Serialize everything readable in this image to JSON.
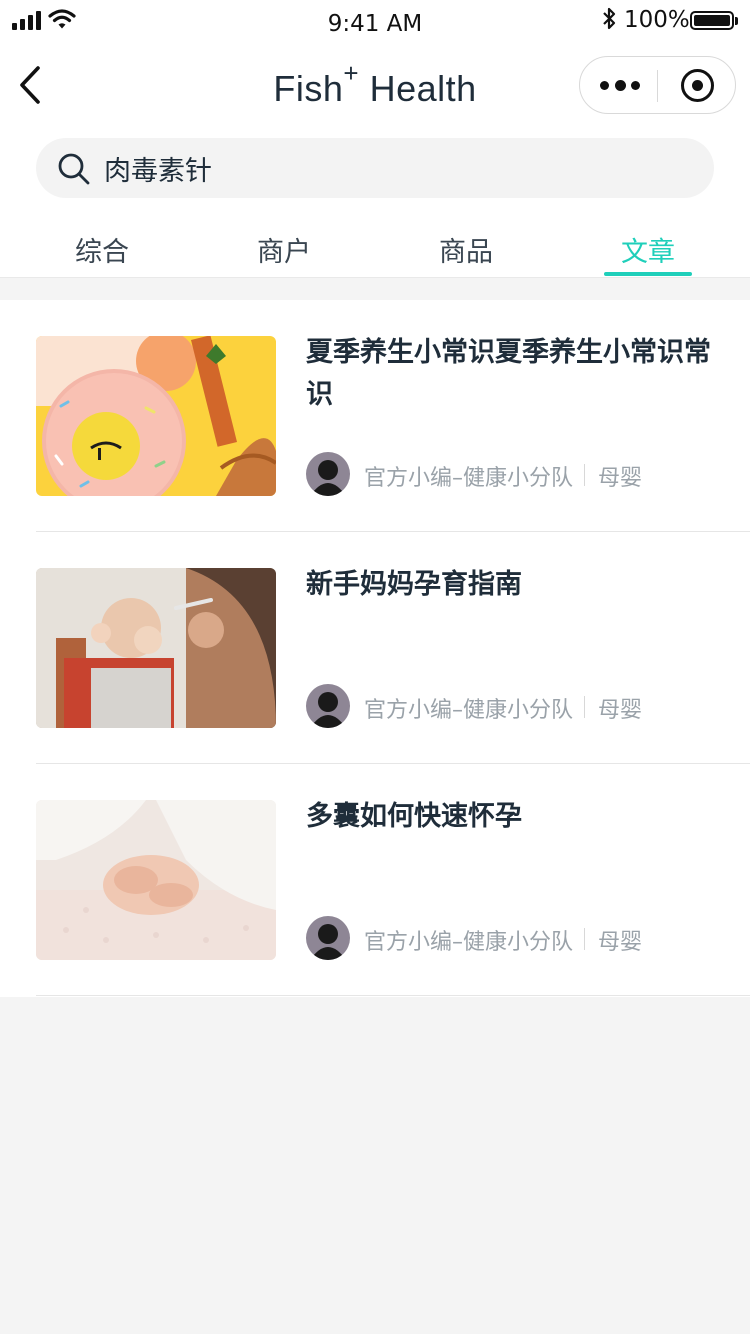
{
  "status_bar": {
    "time": "9:41 AM",
    "battery": "100%"
  },
  "nav": {
    "title": "Fish",
    "title_sup": "+",
    "title_rest": "Health"
  },
  "search": {
    "value": "肉毒素针"
  },
  "tabs": [
    {
      "label": "综合"
    },
    {
      "label": "商户"
    },
    {
      "label": "商品"
    },
    {
      "label": "文章"
    }
  ],
  "active_tab": 3,
  "colors": {
    "accent": "#1fcfba",
    "text": "#1f2d3a",
    "muted": "#9aa2a9"
  },
  "articles": [
    {
      "title": "夏季养生小常识夏季养生小常识常识",
      "author": "官方小编–健康小分队",
      "category": "母婴",
      "thumb_icon": "donut-float-photo"
    },
    {
      "title": "新手妈妈孕育指南",
      "author": "官方小编–健康小分队",
      "category": "母婴",
      "thumb_icon": "baby-feeding-photo"
    },
    {
      "title": "多囊如何快速怀孕",
      "author": "官方小编–健康小分队",
      "category": "母婴",
      "thumb_icon": "hands-sweater-photo"
    }
  ]
}
